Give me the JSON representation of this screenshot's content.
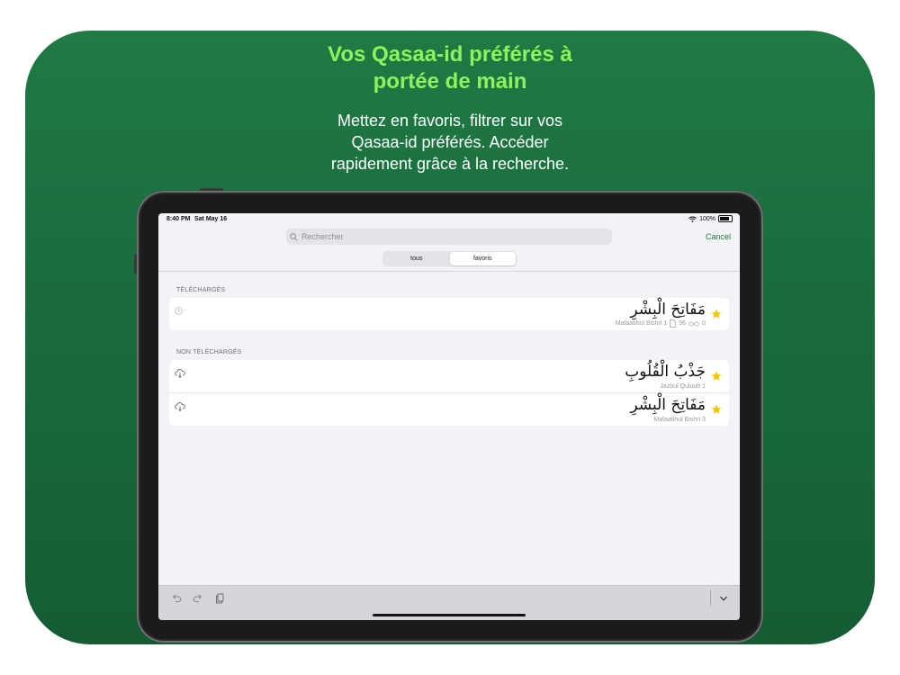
{
  "promo": {
    "headline_line1": "Vos Qasaa-id préférés à",
    "headline_line2": "portée de main",
    "sub_line1": "Mettez en favoris, filtrer sur vos",
    "sub_line2": "Qasaa-id préférés. Accéder",
    "sub_line3": "rapidement grâce à la recherche."
  },
  "colors": {
    "background_green": "#1f7a43",
    "headline_green": "#8ef25f",
    "accent_green": "#1e7a3e",
    "star_yellow": "#f7c600"
  },
  "status_bar": {
    "time": "8:40 PM",
    "date": "Sat May 16",
    "battery": "100%"
  },
  "search": {
    "placeholder": "Rechercher",
    "cancel_label": "Cancel"
  },
  "segments": [
    {
      "label": "tous",
      "active": false
    },
    {
      "label": "favoris",
      "active": true
    }
  ],
  "sections": {
    "downloaded": {
      "header": "TÉLÉCHARGÉS",
      "items": [
        {
          "arabic": "مَفَاتِحَ الْبِشْرِ",
          "name": "Mafaatihul Bishri 1",
          "pages": "96",
          "views": "0",
          "status": "-"
        }
      ]
    },
    "not_downloaded": {
      "header": "NON TÉLÉCHARGÉS",
      "items": [
        {
          "arabic": "جَذْبُ الْقُلُوبِ",
          "name": "Jazbul Quluub 1"
        },
        {
          "arabic": "مَفَاتِحَ الْبِشْرِ",
          "name": "Mafaatihul Bishri 3"
        }
      ]
    }
  },
  "icons": {
    "search": "search-icon",
    "wifi": "wifi-icon",
    "battery": "battery-icon",
    "clock": "clock-icon",
    "document": "document-icon",
    "glasses": "glasses-icon",
    "cloud_download": "cloud-download-icon",
    "star": "star-icon",
    "undo": "undo-icon",
    "redo": "redo-icon",
    "clipboard": "clipboard-icon",
    "chevron_down": "chevron-down-icon"
  }
}
